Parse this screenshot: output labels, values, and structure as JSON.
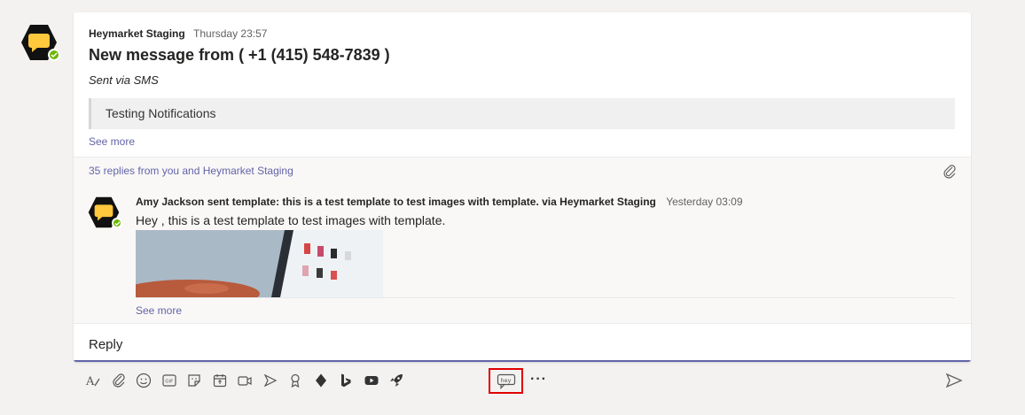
{
  "message": {
    "sender": "Heymarket Staging",
    "timestamp": "Thursday 23:57",
    "title": "New message from ( +1 (415) 548-7839 )",
    "subtitle": "Sent via SMS",
    "quote": "Testing Notifications",
    "see_more": "See more"
  },
  "thread": {
    "replies_link": "35 replies from you and Heymarket Staging",
    "reply": {
      "header": "Amy Jackson sent template: this is a test template to test images with template. via Heymarket Staging",
      "timestamp": "Yesterday 03:09",
      "body": "Hey , this is a test template to test images with template.",
      "see_more": "See more"
    }
  },
  "reply_box": {
    "label": "Reply"
  },
  "toolbar": {
    "icons": [
      "format-icon",
      "attach-icon",
      "emoji-icon",
      "gif-icon",
      "sticker-icon",
      "schedule-meeting-icon",
      "meet-now-icon",
      "stream-icon",
      "praise-icon",
      "diamond-app-icon",
      "bing-icon",
      "youtube-icon",
      "rocket-app-icon",
      "heymarket-app-icon",
      "more-options-icon",
      "send-icon"
    ],
    "gif_label": "GIF",
    "hey_label": "hey",
    "more": "···"
  },
  "colors": {
    "accent": "#6264a7",
    "highlight_border": "#e00000",
    "status_green": "#6bb700",
    "avatar_yellow": "#ffc83d"
  }
}
